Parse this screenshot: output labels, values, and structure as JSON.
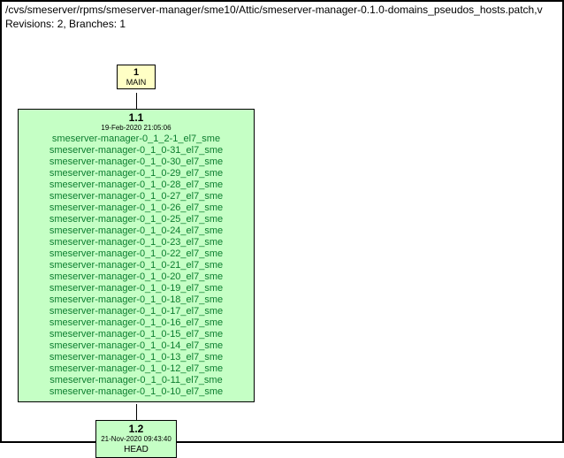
{
  "header": {
    "filepath": "/cvs/smeserver/rpms/smeserver-manager/sme10/Attic/smeserver-manager-0.1.0-domains_pseudos_hosts.patch,v",
    "meta": "Revisions: 2, Branches: 1"
  },
  "main_branch": {
    "num": "1",
    "label": "MAIN"
  },
  "rev11": {
    "title": "1.1",
    "date": "19-Feb-2020 21:05:06",
    "tags": [
      "smeserver-manager-0_1_2-1_el7_sme",
      "smeserver-manager-0_1_0-31_el7_sme",
      "smeserver-manager-0_1_0-30_el7_sme",
      "smeserver-manager-0_1_0-29_el7_sme",
      "smeserver-manager-0_1_0-28_el7_sme",
      "smeserver-manager-0_1_0-27_el7_sme",
      "smeserver-manager-0_1_0-26_el7_sme",
      "smeserver-manager-0_1_0-25_el7_sme",
      "smeserver-manager-0_1_0-24_el7_sme",
      "smeserver-manager-0_1_0-23_el7_sme",
      "smeserver-manager-0_1_0-22_el7_sme",
      "smeserver-manager-0_1_0-21_el7_sme",
      "smeserver-manager-0_1_0-20_el7_sme",
      "smeserver-manager-0_1_0-19_el7_sme",
      "smeserver-manager-0_1_0-18_el7_sme",
      "smeserver-manager-0_1_0-17_el7_sme",
      "smeserver-manager-0_1_0-16_el7_sme",
      "smeserver-manager-0_1_0-15_el7_sme",
      "smeserver-manager-0_1_0-14_el7_sme",
      "smeserver-manager-0_1_0-13_el7_sme",
      "smeserver-manager-0_1_0-12_el7_sme",
      "smeserver-manager-0_1_0-11_el7_sme",
      "smeserver-manager-0_1_0-10_el7_sme"
    ]
  },
  "rev12": {
    "title": "1.2",
    "date": "21-Nov-2020 09:43:40",
    "head": "HEAD"
  }
}
